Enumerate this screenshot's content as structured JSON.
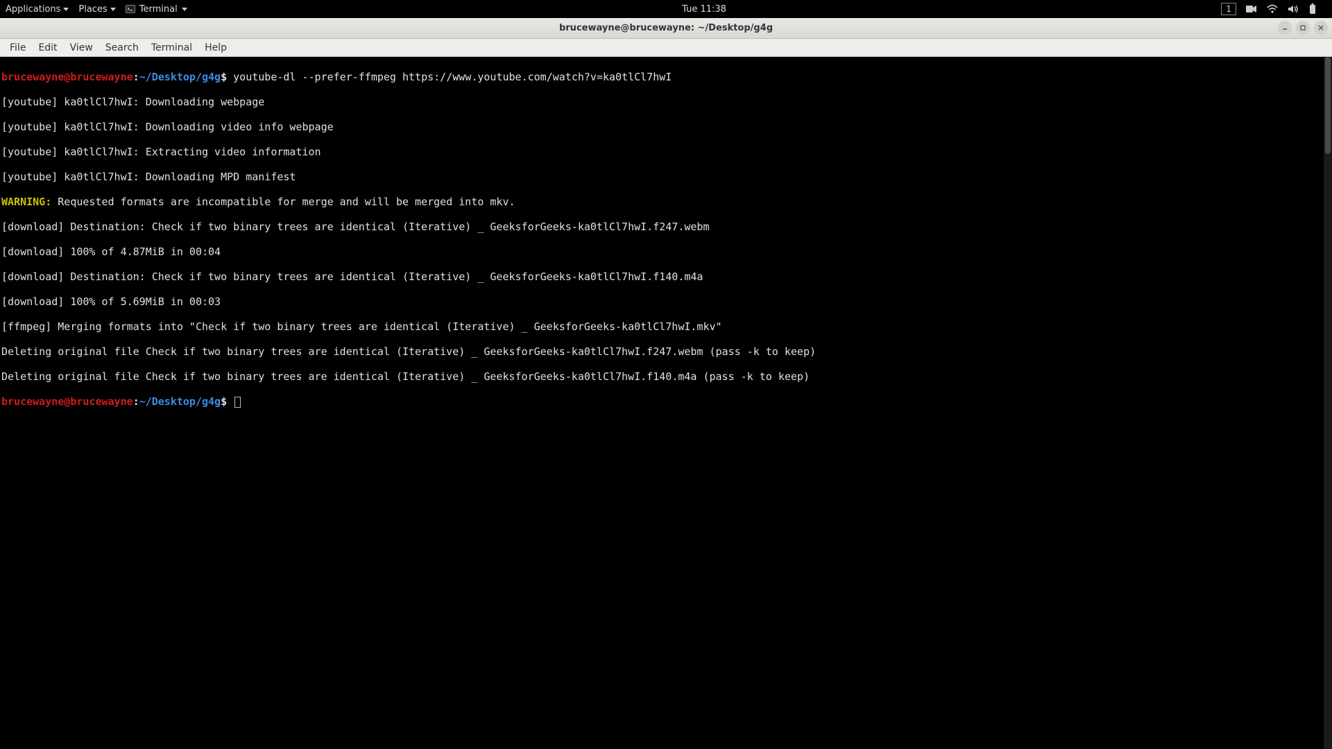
{
  "panel": {
    "applications": "Applications",
    "places": "Places",
    "app_indicator": "Terminal",
    "clock": "Tue 11:38",
    "workspace": "1"
  },
  "titlebar": {
    "title": "brucewayne@brucewayne: ~/Desktop/g4g"
  },
  "menubar": {
    "items": [
      "File",
      "Edit",
      "View",
      "Search",
      "Terminal",
      "Help"
    ]
  },
  "prompt": {
    "user_host": "brucewayne@brucewayne",
    "colon": ":",
    "path": "~/Desktop/g4g",
    "dollar": "$"
  },
  "lines": {
    "cmd1": "youtube-dl --prefer-ffmpeg https://www.youtube.com/watch?v=ka0tlCl7hwI",
    "l2": "[youtube] ka0tlCl7hwI: Downloading webpage",
    "l3": "[youtube] ka0tlCl7hwI: Downloading video info webpage",
    "l4": "[youtube] ka0tlCl7hwI: Extracting video information",
    "l5": "[youtube] ka0tlCl7hwI: Downloading MPD manifest",
    "warn_label": "WARNING:",
    "warn_rest": " Requested formats are incompatible for merge and will be merged into mkv.",
    "l7": "[download] Destination: Check if two binary trees are identical (Iterative) _ GeeksforGeeks-ka0tlCl7hwI.f247.webm",
    "l8": "[download] 100% of 4.87MiB in 00:04",
    "l9": "[download] Destination: Check if two binary trees are identical (Iterative) _ GeeksforGeeks-ka0tlCl7hwI.f140.m4a",
    "l10": "[download] 100% of 5.69MiB in 00:03",
    "l11": "[ffmpeg] Merging formats into \"Check if two binary trees are identical (Iterative) _ GeeksforGeeks-ka0tlCl7hwI.mkv\"",
    "l12": "Deleting original file Check if two binary trees are identical (Iterative) _ GeeksforGeeks-ka0tlCl7hwI.f247.webm (pass -k to keep)",
    "l13": "Deleting original file Check if two binary trees are identical (Iterative) _ GeeksforGeeks-ka0tlCl7hwI.f140.m4a (pass -k to keep)"
  }
}
